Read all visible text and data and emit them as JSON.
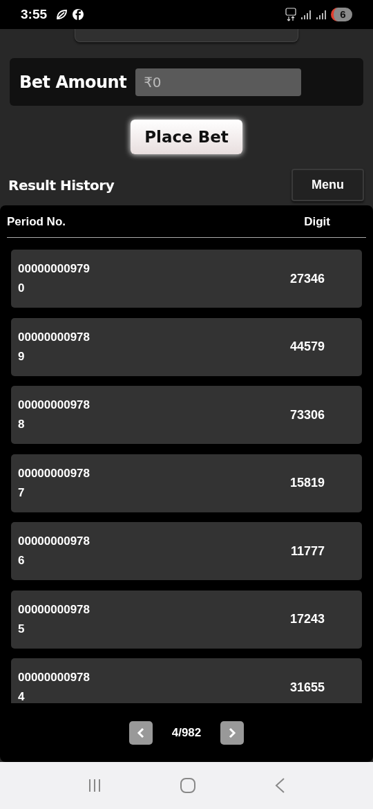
{
  "status_bar": {
    "time": "3:55",
    "battery": "6"
  },
  "bet": {
    "label": "Bet Amount",
    "placeholder": "₹0"
  },
  "place_button": "Place Bet",
  "history": {
    "title": "Result History",
    "menu_button": "Menu"
  },
  "table": {
    "columns": [
      "Period No.",
      "Digit"
    ],
    "rows": [
      {
        "period": "000000009790",
        "digit": "27346"
      },
      {
        "period": "000000009789",
        "digit": "44579"
      },
      {
        "period": "000000009788",
        "digit": "73306"
      },
      {
        "period": "000000009787",
        "digit": "15819"
      },
      {
        "period": "000000009786",
        "digit": "11777"
      },
      {
        "period": "000000009785",
        "digit": "17243"
      },
      {
        "period": "000000009784",
        "digit": "31655"
      }
    ]
  },
  "pagination": {
    "page": "4/982"
  }
}
